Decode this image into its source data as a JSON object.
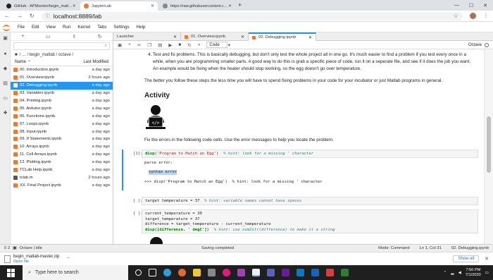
{
  "browser": {
    "tabs": [
      {
        "label": "GitHub - APMonitor/begin_matl…",
        "active": false
      },
      {
        "label": "JupyterLab",
        "active": true
      },
      {
        "label": "https://raw.githubusercontent.c…",
        "active": false
      }
    ],
    "url": "localhost:8889/lab"
  },
  "menu": [
    "File",
    "Edit",
    "View",
    "Run",
    "Kernel",
    "Tabs",
    "Settings",
    "Help"
  ],
  "filebrowser": {
    "breadcrumb": "/ … / begin_matlab / octave /",
    "header_name": "Name",
    "header_modified": "Last Modified",
    "files": [
      {
        "name": "00. Introduction.ipynb",
        "modified": "a day ago",
        "selected": false
      },
      {
        "name": "01. Overview.ipynb",
        "modified": "2 hours ago",
        "selected": false
      },
      {
        "name": "02. Debugging.ipynb",
        "modified": "a day ago",
        "selected": true
      },
      {
        "name": "03. Variables.ipynb",
        "modified": "a day ago",
        "selected": false
      },
      {
        "name": "04. Printing.ipynb",
        "modified": "a day ago",
        "selected": false
      },
      {
        "name": "05. Arduino.ipynb",
        "modified": "a day ago",
        "selected": false
      },
      {
        "name": "06. Functions.ipynb",
        "modified": "a day ago",
        "selected": false
      },
      {
        "name": "07. Loops.ipynb",
        "modified": "a day ago",
        "selected": false
      },
      {
        "name": "08. Input.ipynb",
        "modified": "a day ago",
        "selected": false
      },
      {
        "name": "09. If Statements.ipynb",
        "modified": "a day ago",
        "selected": false
      },
      {
        "name": "10. Arrays.ipynb",
        "modified": "a day ago",
        "selected": false
      },
      {
        "name": "11. Cell Arrays.ipynb",
        "modified": "a day ago",
        "selected": false
      },
      {
        "name": "12. Plotting.ipynb",
        "modified": "a day ago",
        "selected": false
      },
      {
        "name": "TCLab Help.ipynb",
        "modified": "a day ago",
        "selected": false
      },
      {
        "name": "tclab.m",
        "modified": "2 hours ago",
        "selected": false
      },
      {
        "name": "XX. Final Project.ipynb",
        "modified": "a day ago",
        "selected": false
      }
    ]
  },
  "doctabs": [
    {
      "label": "Launcher",
      "active": false
    },
    {
      "label": "01. Overview.ipynb",
      "active": false
    },
    {
      "label": "02. Debugging.ipynb",
      "active": true
    }
  ],
  "toolbar": {
    "cell_type": "Code",
    "kernel": "Octave"
  },
  "notebook": {
    "step4": "Test and fix problems. This is basically debugging, but don't only test the whole project all in one go. It's much easier to find a problem if you test every once in a while, when you are programming smaller parts. A good way to do this is grab a specific piece of code, run it on a seperate file, and see if it does the job you want. An example would be fixing when the heater should stop working, so the egg doesn't go over temperature.",
    "para": "The better you follow these steps the less time you will have to spend fixing problems in your code for your incubator or just Matlab programs in general.",
    "heading": "Activity",
    "instruction": "Fix the errors in the following code cells. Use the error messages to help you locate the problem.",
    "cell1": {
      "prompt": "[1]:",
      "fn": "disp",
      "open": "(",
      "string": "'Program to Hatch an Egg'",
      "close": ")",
      "comment": "% hint: look for a missing ' character",
      "out1": "parse error:",
      "out2": "syntax error",
      "out3": ">>> disp('Program to Hatch an Egg')  % hint: look for a missing ' character"
    },
    "cell2": {
      "prompt": "[ ]:",
      "code": "target temperature = 37",
      "comment": "% hint: variable names cannot have spaces"
    },
    "cell3": {
      "prompt": "[ ]:",
      "line1": "current_temperature = 30",
      "line2": "target_temperature = 37",
      "line3": "difference = target_temperature - current_temperature",
      "line4_code": "disp([difference, ' degC'])",
      "line4_comment": "% hint: use num2str(difference) to make it a string"
    }
  },
  "status": {
    "left_counts": "0  2",
    "kernel": "Octave | Idle",
    "center": "Saving completed",
    "mode": "Mode: Command",
    "position": "Ln 1, Col 31",
    "file": "02. Debugging.ipynb"
  },
  "download": {
    "filename": "begin_matlab-master.zip",
    "action": "Open file",
    "show_all": "Show all"
  },
  "taskbar": {
    "search_placeholder": "Type here to search",
    "time": "7:56 PM",
    "date": "7/1/2020"
  },
  "colors": {
    "accent": "#2196f3",
    "jupyter_orange": "#f37726",
    "taskbar": "#1f1f1f"
  }
}
